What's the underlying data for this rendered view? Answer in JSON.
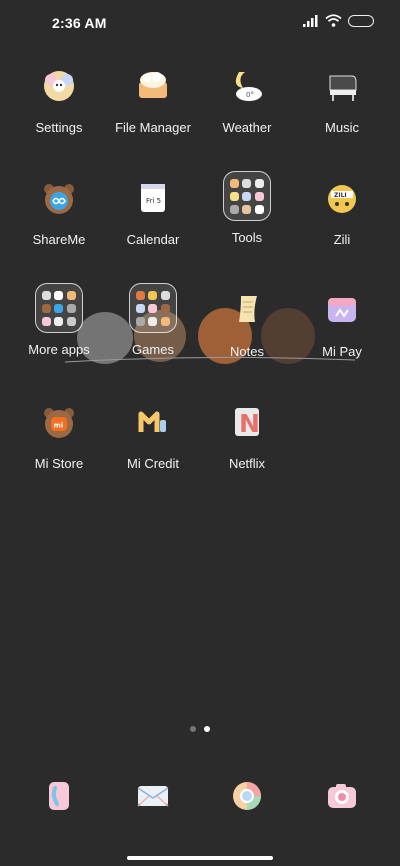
{
  "status": {
    "time": "2:36 AM"
  },
  "apps": [
    {
      "label": "Settings"
    },
    {
      "label": "File Manager"
    },
    {
      "label": "Weather",
      "icon_text": "0°"
    },
    {
      "label": "Music"
    },
    {
      "label": "ShareMe"
    },
    {
      "label": "Calendar",
      "icon_text": "Fri 5"
    },
    {
      "label": "Tools"
    },
    {
      "label": "Zili",
      "icon_text": "ZILI"
    },
    {
      "label": "More apps"
    },
    {
      "label": "Games"
    },
    {
      "label": "Notes"
    },
    {
      "label": "Mi Pay"
    },
    {
      "label": "Mi Store",
      "icon_text": "mi"
    },
    {
      "label": "Mi Credit"
    },
    {
      "label": "Netflix",
      "icon_text": "N"
    }
  ],
  "dock": [
    {
      "name": "phone"
    },
    {
      "name": "messages"
    },
    {
      "name": "browser"
    },
    {
      "name": "camera"
    }
  ],
  "pages": {
    "count": 2,
    "active": 2
  }
}
